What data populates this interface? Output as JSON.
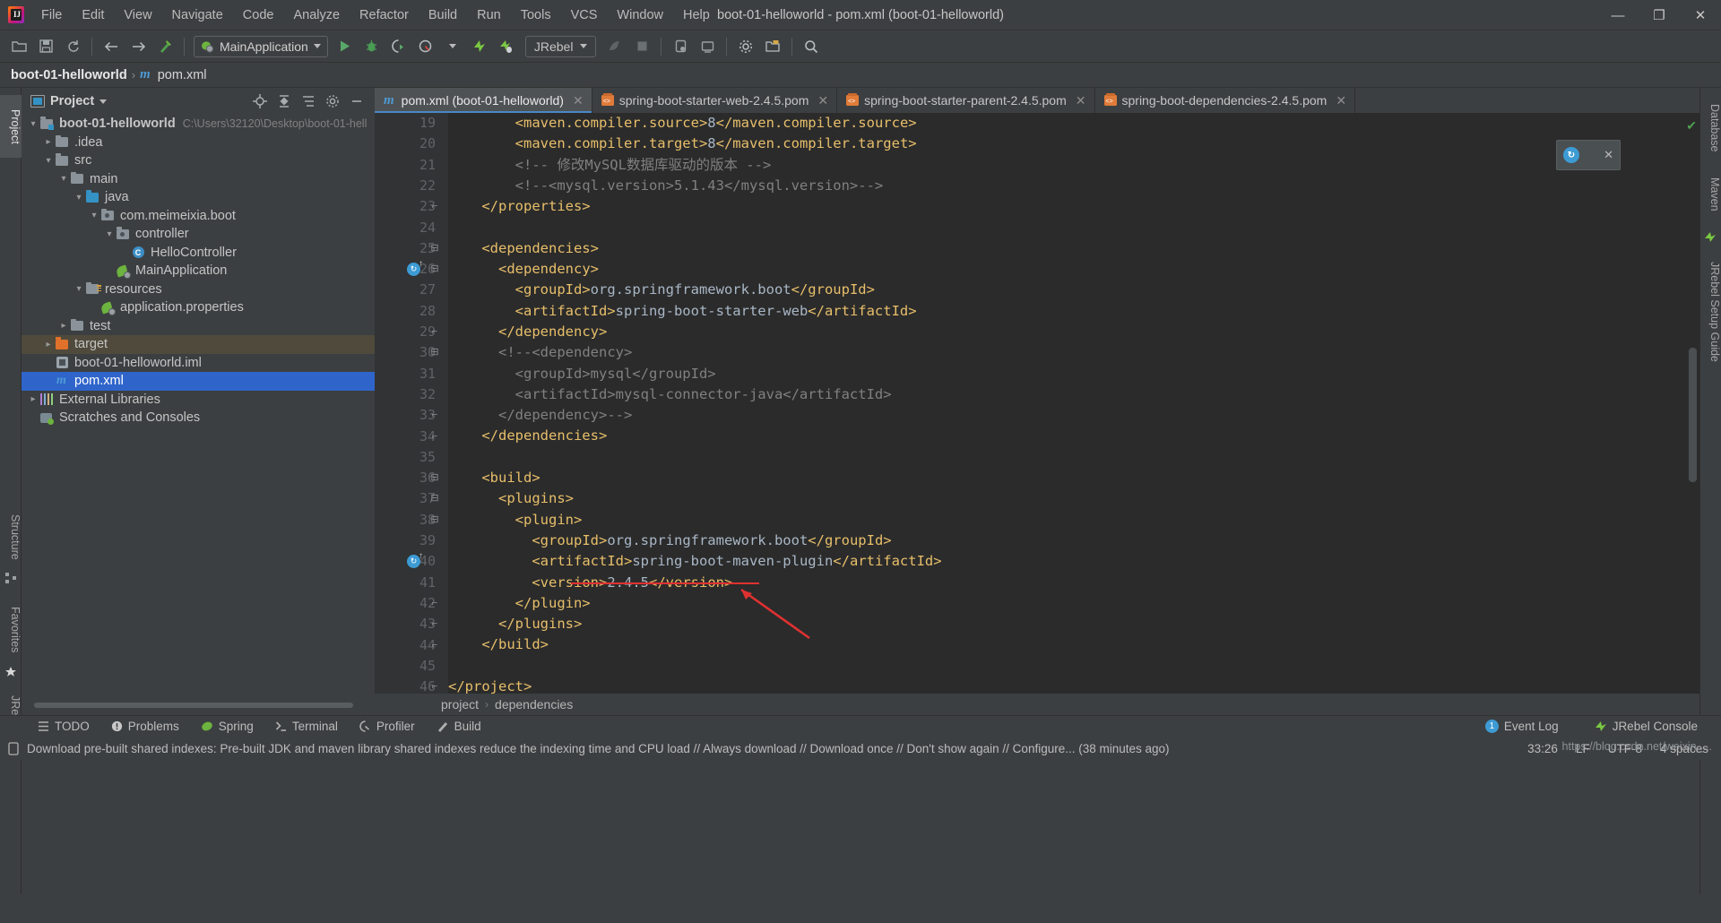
{
  "window": {
    "title": "boot-01-helloworld - pom.xml (boot-01-helloworld)",
    "minimize": "—",
    "maximize": "❐",
    "close": "✕"
  },
  "menubar": [
    {
      "label": "File"
    },
    {
      "label": "Edit"
    },
    {
      "label": "View"
    },
    {
      "label": "Navigate"
    },
    {
      "label": "Code"
    },
    {
      "label": "Analyze"
    },
    {
      "label": "Refactor"
    },
    {
      "label": "Build"
    },
    {
      "label": "Run"
    },
    {
      "label": "Tools"
    },
    {
      "label": "VCS"
    },
    {
      "label": "Window"
    },
    {
      "label": "Help"
    }
  ],
  "toolbar": {
    "run_config": "MainApplication",
    "jrebel_label": "JRebel",
    "icons": [
      "open-folder-icon",
      "save-all-icon",
      "sync-icon",
      "back-arrow-icon",
      "forward-arrow-icon",
      "build-hammer-icon"
    ]
  },
  "navbar": {
    "project": "boot-01-helloworld",
    "separator": "›",
    "file": "pom.xml"
  },
  "left_stripe": [
    {
      "label": "Project",
      "active": true
    },
    {
      "label": "Structure",
      "active": false
    },
    {
      "label": "Favorites",
      "active": false
    },
    {
      "label": "JRebel",
      "active": false
    }
  ],
  "right_stripe": [
    {
      "label": "Database"
    },
    {
      "label": "Maven"
    },
    {
      "label": "JRebel Setup Guide"
    }
  ],
  "project_panel": {
    "title": "Project",
    "header_icons": [
      "locate-target-icon",
      "collapse-all-icon",
      "expand-select-icon",
      "gear-icon",
      "hide-icon"
    ],
    "tree": [
      {
        "indent": 0,
        "arrow": "v",
        "icon": "module-folder",
        "label": "boot-01-helloworld",
        "bold": true,
        "path": "C:\\Users\\32120\\Desktop\\boot-01-hell",
        "state": "normal"
      },
      {
        "indent": 1,
        "arrow": ">",
        "icon": "folder",
        "label": ".idea",
        "bold": false,
        "path": "",
        "state": "normal"
      },
      {
        "indent": 1,
        "arrow": "v",
        "icon": "folder",
        "label": "src",
        "bold": false,
        "path": "",
        "state": "normal"
      },
      {
        "indent": 2,
        "arrow": "v",
        "icon": "folder",
        "label": "main",
        "bold": false,
        "path": "",
        "state": "normal"
      },
      {
        "indent": 3,
        "arrow": "v",
        "icon": "folder-blue",
        "label": "java",
        "bold": false,
        "path": "",
        "state": "normal"
      },
      {
        "indent": 4,
        "arrow": "v",
        "icon": "package",
        "label": "com.meimeixia.boot",
        "bold": false,
        "path": "",
        "state": "normal"
      },
      {
        "indent": 5,
        "arrow": "v",
        "icon": "package",
        "label": "controller",
        "bold": false,
        "path": "",
        "state": "normal"
      },
      {
        "indent": 6,
        "arrow": "",
        "icon": "java-class",
        "label": "HelloController",
        "bold": false,
        "path": "",
        "state": "normal"
      },
      {
        "indent": 5,
        "arrow": "",
        "icon": "spring-class",
        "label": "MainApplication",
        "bold": false,
        "path": "",
        "state": "normal"
      },
      {
        "indent": 3,
        "arrow": "v",
        "icon": "resources-folder",
        "label": "resources",
        "bold": false,
        "path": "",
        "state": "normal"
      },
      {
        "indent": 4,
        "arrow": "",
        "icon": "spring-properties",
        "label": "application.properties",
        "bold": false,
        "path": "",
        "state": "normal"
      },
      {
        "indent": 2,
        "arrow": ">",
        "icon": "folder",
        "label": "test",
        "bold": false,
        "path": "",
        "state": "normal"
      },
      {
        "indent": 1,
        "arrow": ">",
        "icon": "folder-orange",
        "label": "target",
        "bold": false,
        "path": "",
        "state": "target-hl"
      },
      {
        "indent": 1,
        "arrow": "",
        "icon": "iml-file",
        "label": "boot-01-helloworld.iml",
        "bold": false,
        "path": "",
        "state": "normal"
      },
      {
        "indent": 1,
        "arrow": "",
        "icon": "maven-pom",
        "label": "pom.xml",
        "bold": false,
        "path": "",
        "state": "selected"
      },
      {
        "indent": 0,
        "arrow": ">",
        "icon": "libraries",
        "label": "External Libraries",
        "bold": false,
        "path": "",
        "state": "normal"
      },
      {
        "indent": 0,
        "arrow": "",
        "icon": "scratches",
        "label": "Scratches and Consoles",
        "bold": false,
        "path": "",
        "state": "normal"
      }
    ]
  },
  "editor": {
    "tabs": [
      {
        "label": "pom.xml (boot-01-helloworld)",
        "icon": "maven-m-icon",
        "active": true,
        "closable": true
      },
      {
        "label": "spring-boot-starter-web-2.4.5.pom",
        "icon": "maven-pom-icon",
        "active": false,
        "closable": true
      },
      {
        "label": "spring-boot-starter-parent-2.4.5.pom",
        "icon": "maven-pom-icon",
        "active": false,
        "closable": true
      },
      {
        "label": "spring-boot-dependencies-2.4.5.pom",
        "icon": "maven-pom-icon",
        "active": false,
        "closable": true
      }
    ],
    "first_line_number": 19,
    "lines": [
      {
        "n": 19,
        "fold": "",
        "marker": "",
        "indent": 8,
        "segs": [
          {
            "t": "<maven.compiler.source>",
            "c": "tag"
          },
          {
            "t": "8",
            "c": "txt"
          },
          {
            "t": "</maven.compiler.source>",
            "c": "tag"
          }
        ]
      },
      {
        "n": 20,
        "fold": "",
        "marker": "",
        "indent": 8,
        "segs": [
          {
            "t": "<maven.compiler.target>",
            "c": "tag"
          },
          {
            "t": "8",
            "c": "txt"
          },
          {
            "t": "</maven.compiler.target>",
            "c": "tag"
          }
        ]
      },
      {
        "n": 21,
        "fold": "",
        "marker": "",
        "indent": 8,
        "segs": [
          {
            "t": "<!-- 修改MySQL数据库驱动的版本 -->",
            "c": "cmt"
          }
        ]
      },
      {
        "n": 22,
        "fold": "",
        "marker": "",
        "indent": 8,
        "segs": [
          {
            "t": "<!--<mysql.version>5.1.43</mysql.version>-->",
            "c": "cmt"
          }
        ]
      },
      {
        "n": 23,
        "fold": "end",
        "marker": "",
        "indent": 4,
        "segs": [
          {
            "t": "</properties>",
            "c": "tag"
          }
        ]
      },
      {
        "n": 24,
        "fold": "",
        "marker": "",
        "indent": 0,
        "segs": []
      },
      {
        "n": 25,
        "fold": "start",
        "marker": "",
        "indent": 4,
        "segs": [
          {
            "t": "<dependencies>",
            "c": "tag"
          }
        ]
      },
      {
        "n": 26,
        "fold": "start",
        "marker": "run",
        "indent": 6,
        "segs": [
          {
            "t": "<dependency>",
            "c": "tag"
          }
        ]
      },
      {
        "n": 27,
        "fold": "",
        "marker": "",
        "indent": 8,
        "segs": [
          {
            "t": "<groupId>",
            "c": "tag"
          },
          {
            "t": "org.springframework.boot",
            "c": "txt"
          },
          {
            "t": "</groupId>",
            "c": "tag"
          }
        ]
      },
      {
        "n": 28,
        "fold": "",
        "marker": "",
        "indent": 8,
        "segs": [
          {
            "t": "<artifactId>",
            "c": "tag"
          },
          {
            "t": "spring-boot-starter-web",
            "c": "txt"
          },
          {
            "t": "</artifactId>",
            "c": "tag"
          }
        ]
      },
      {
        "n": 29,
        "fold": "end",
        "marker": "",
        "indent": 6,
        "segs": [
          {
            "t": "</dependency>",
            "c": "tag"
          }
        ]
      },
      {
        "n": 30,
        "fold": "start",
        "marker": "",
        "indent": 6,
        "segs": [
          {
            "t": "<!--<dependency>",
            "c": "cmt"
          }
        ]
      },
      {
        "n": 31,
        "fold": "",
        "marker": "",
        "indent": 8,
        "segs": [
          {
            "t": "<groupId>mysql</groupId>",
            "c": "cmt"
          }
        ]
      },
      {
        "n": 32,
        "fold": "",
        "marker": "",
        "indent": 8,
        "segs": [
          {
            "t": "<artifactId>mysql-connector-java</artifactId>",
            "c": "cmt"
          }
        ]
      },
      {
        "n": 33,
        "fold": "end",
        "marker": "",
        "indent": 6,
        "segs": [
          {
            "t": "</dependency>-->",
            "c": "cmt"
          }
        ]
      },
      {
        "n": 34,
        "fold": "end",
        "marker": "",
        "indent": 4,
        "segs": [
          {
            "t": "</dependencies>",
            "c": "tag"
          }
        ]
      },
      {
        "n": 35,
        "fold": "",
        "marker": "",
        "indent": 0,
        "segs": []
      },
      {
        "n": 36,
        "fold": "start",
        "marker": "",
        "indent": 4,
        "segs": [
          {
            "t": "<build>",
            "c": "tag"
          }
        ]
      },
      {
        "n": 37,
        "fold": "start",
        "marker": "",
        "indent": 6,
        "segs": [
          {
            "t": "<plugins>",
            "c": "tag"
          }
        ]
      },
      {
        "n": 38,
        "fold": "start",
        "marker": "",
        "indent": 8,
        "segs": [
          {
            "t": "<plugin>",
            "c": "tag"
          }
        ]
      },
      {
        "n": 39,
        "fold": "",
        "marker": "",
        "indent": 10,
        "segs": [
          {
            "t": "<groupId>",
            "c": "tag"
          },
          {
            "t": "org.springframework.boot",
            "c": "txt"
          },
          {
            "t": "</groupId>",
            "c": "tag"
          }
        ]
      },
      {
        "n": 40,
        "fold": "",
        "marker": "run",
        "indent": 10,
        "segs": [
          {
            "t": "<artifactId>",
            "c": "tag"
          },
          {
            "t": "spring-boot-maven-plugin",
            "c": "txt"
          },
          {
            "t": "</artifactId>",
            "c": "tag"
          }
        ]
      },
      {
        "n": 41,
        "fold": "",
        "marker": "",
        "indent": 10,
        "segs": [
          {
            "t": "<version>",
            "c": "tag"
          },
          {
            "t": "2.4.5",
            "c": "txt"
          },
          {
            "t": "</version>",
            "c": "tag"
          }
        ]
      },
      {
        "n": 42,
        "fold": "end",
        "marker": "",
        "indent": 8,
        "segs": [
          {
            "t": "</plugin>",
            "c": "tag"
          }
        ]
      },
      {
        "n": 43,
        "fold": "end",
        "marker": "",
        "indent": 6,
        "segs": [
          {
            "t": "</plugins>",
            "c": "tag"
          }
        ]
      },
      {
        "n": 44,
        "fold": "end",
        "marker": "",
        "indent": 4,
        "segs": [
          {
            "t": "</build>",
            "c": "tag"
          }
        ]
      },
      {
        "n": 45,
        "fold": "",
        "marker": "",
        "indent": 0,
        "segs": []
      },
      {
        "n": 46,
        "fold": "end",
        "marker": "",
        "indent": 0,
        "segs": [
          {
            "t": "</project>",
            "c": "tag"
          }
        ]
      }
    ],
    "inspection_status": "✔",
    "breadcrumb": [
      "project",
      "dependencies"
    ]
  },
  "jrebel_popup": {
    "icon_label": "↻",
    "close": "✕"
  },
  "bottom_bar": {
    "items": [
      {
        "label": "TODO",
        "icon": "todo-icon"
      },
      {
        "label": "Problems",
        "icon": "problems-icon"
      },
      {
        "label": "Spring",
        "icon": "spring-leaf-icon"
      },
      {
        "label": "Terminal",
        "icon": "terminal-icon"
      },
      {
        "label": "Profiler",
        "icon": "profiler-icon"
      },
      {
        "label": "Build",
        "icon": "build-hammer-icon"
      }
    ],
    "right": [
      {
        "label": "Event Log",
        "badge": "1"
      },
      {
        "label": "JRebel Console",
        "badge": ""
      }
    ]
  },
  "status_bar": {
    "message": "Download pre-built shared indexes: Pre-built JDK and maven library shared indexes reduce the indexing time and CPU load // Always download // Download once // Don't show again // Configure... (38 minutes ago)",
    "caret": "33:26",
    "line_sep": "LF",
    "encoding": "UTF-8",
    "indent": "4 spaces"
  },
  "watermark": "https://blog.csdn.net/weixin_...",
  "colors": {
    "accent": "#4a88c7",
    "tag": "#e8bf6a",
    "text": "#a9b7c6",
    "comment": "#808080",
    "selection": "#2f65ca",
    "annotation": "#e03131",
    "editor_bg": "#2b2b2b",
    "panel_bg": "#3c3f41"
  }
}
